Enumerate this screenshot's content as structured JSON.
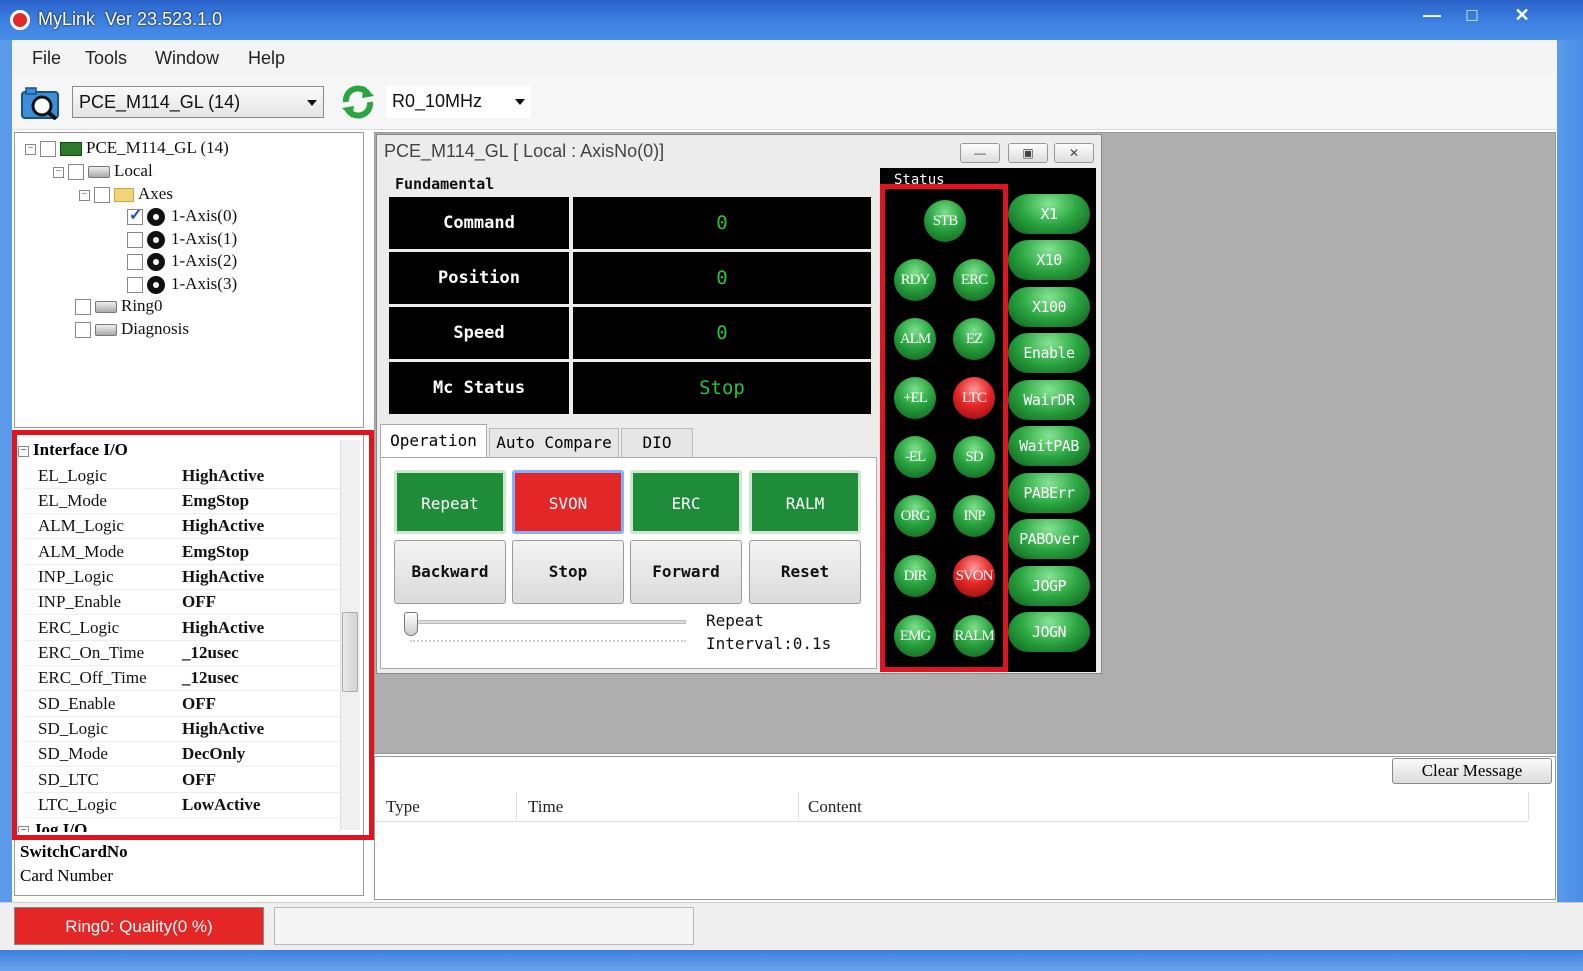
{
  "window": {
    "app_name": "MyLink",
    "version": "Ver 23.523.1.0",
    "controls": {
      "minimize": "—",
      "maximize": "□",
      "close": "✕"
    }
  },
  "menu": [
    "File",
    "Tools",
    "Window",
    "Help"
  ],
  "toolbar": {
    "card_select": "PCE_M114_GL (14)",
    "clock_select": "R0_10MHz"
  },
  "tree": {
    "root": "PCE_M114_GL (14)",
    "local": "Local",
    "axes": "Axes",
    "axis_items": [
      "1-Axis(0)",
      "1-Axis(1)",
      "1-Axis(2)",
      "1-Axis(3)"
    ],
    "ring": "Ring0",
    "diagnosis": "Diagnosis"
  },
  "properties": {
    "category": "Interface I/O",
    "next_category": "Jog I/O",
    "rows": [
      {
        "name": "EL_Logic",
        "value": "HighActive"
      },
      {
        "name": "EL_Mode",
        "value": "EmgStop"
      },
      {
        "name": "ALM_Logic",
        "value": "HighActive"
      },
      {
        "name": "ALM_Mode",
        "value": "EmgStop"
      },
      {
        "name": "INP_Logic",
        "value": "HighActive"
      },
      {
        "name": "INP_Enable",
        "value": "OFF"
      },
      {
        "name": "ERC_Logic",
        "value": "HighActive"
      },
      {
        "name": "ERC_On_Time",
        "value": "_12usec"
      },
      {
        "name": "ERC_Off_Time",
        "value": "_12usec"
      },
      {
        "name": "SD_Enable",
        "value": "OFF"
      },
      {
        "name": "SD_Logic",
        "value": "HighActive"
      },
      {
        "name": "SD_Mode",
        "value": "DecOnly"
      },
      {
        "name": "SD_LTC",
        "value": "OFF"
      },
      {
        "name": "LTC_Logic",
        "value": "LowActive"
      }
    ],
    "desc_title": "SwitchCardNo",
    "desc_text": "Card Number"
  },
  "axis_window": {
    "title": "PCE_M114_GL [ Local : AxisNo(0)]",
    "fundamental_label": "Fundamental",
    "fields": [
      {
        "label": "Command",
        "value": "0"
      },
      {
        "label": "Position",
        "value": "0"
      },
      {
        "label": "Speed",
        "value": "0"
      },
      {
        "label": "Mc Status",
        "value": "Stop"
      }
    ],
    "tabs": [
      "Operation",
      "Auto Compare",
      "DIO"
    ],
    "op_buttons_row1": [
      "Repeat",
      "SVON",
      "ERC",
      "RALM"
    ],
    "op_buttons_row2": [
      "Backward",
      "Stop",
      "Forward",
      "Reset"
    ],
    "repeat_label": "Repeat",
    "interval_label": "Interval:0.1s",
    "status_label": "Status",
    "leds": {
      "stb": "STB",
      "rdy": "RDY",
      "erc": "ERC",
      "alm": "ALM",
      "ez": "EZ",
      "pel": "+EL",
      "ltc": "LTC",
      "mel": "-EL",
      "sd": "SD",
      "org": "ORG",
      "inp": "INP",
      "dir": "DIR",
      "svon": "SVON",
      "emg": "EMG",
      "ralm": "RALM"
    },
    "led_states": {
      "ltc": "red",
      "svon": "red",
      "others": "green"
    },
    "side_buttons": [
      "X1",
      "X10",
      "X100",
      "Enable",
      "WairDR",
      "WaitPAB",
      "PABErr",
      "PABOver",
      "JOGP",
      "JOGN"
    ]
  },
  "messages": {
    "clear_button": "Clear Message",
    "columns": [
      "Type",
      "Time",
      "Content"
    ]
  },
  "statusbar": {
    "ring_status": "Ring0: Quality(0 %)"
  },
  "colors": {
    "accent_red": "#e52626",
    "led_green": "#2aa540",
    "fund_value_green": "#28c43c",
    "title_blue": "#3c7ee0"
  }
}
